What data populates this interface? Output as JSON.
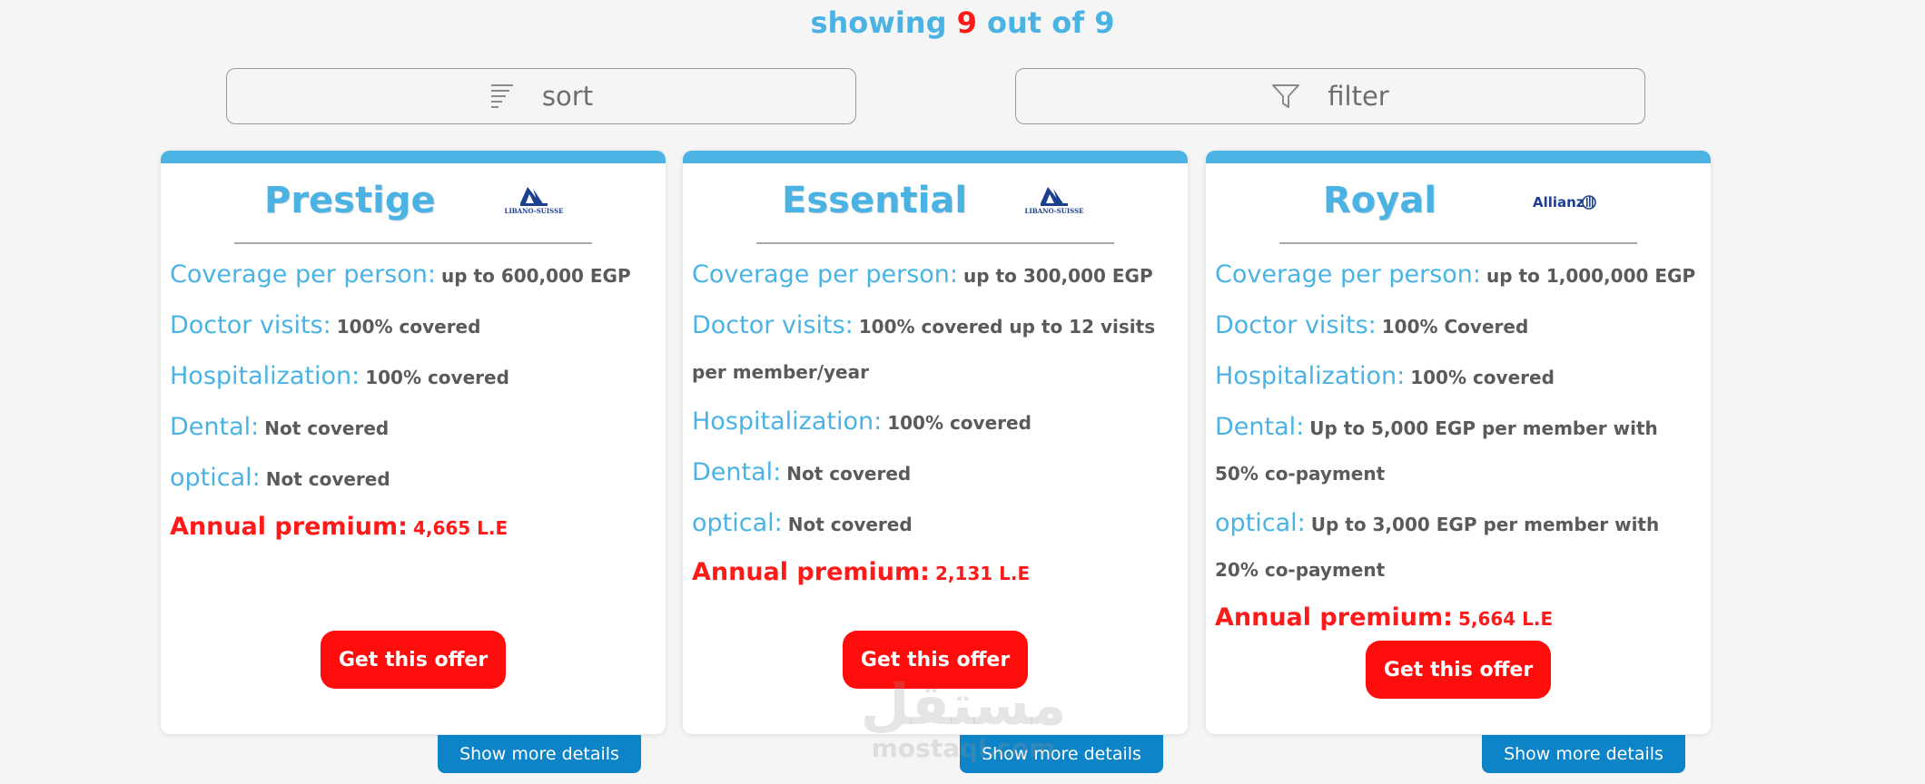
{
  "header": {
    "prefix": "showing",
    "count": "9",
    "middle": "out of",
    "total": "9"
  },
  "controls": {
    "sort_label": "sort",
    "filter_label": "filter"
  },
  "colors": {
    "accent": "#4bb3e3",
    "premium": "#ff1a1a",
    "button": "#ff0d0d",
    "details": "#0d84c7"
  },
  "cards": [
    {
      "name": "Prestige",
      "logo_text": "LIBANO-SUISSE",
      "coverage_label": "Coverage per person:",
      "coverage_value": "up to 600,000 EGP",
      "doctor_label": "Doctor visits:",
      "doctor_value": "100% covered",
      "hosp_label": "Hospitalization:",
      "hosp_value": "100% covered",
      "dental_label": "Dental:",
      "dental_value": "Not covered",
      "optical_label": "optical:",
      "optical_value": "Not covered",
      "premium_label": "Annual premium:",
      "premium_value": "4,665 L.E",
      "cta": "Get this offer",
      "details": "Show more details"
    },
    {
      "name": "Essential",
      "logo_text": "LIBANO-SUISSE",
      "coverage_label": "Coverage per person:",
      "coverage_value": "up to 300,000 EGP",
      "doctor_label": "Doctor visits:",
      "doctor_value": "100% covered up to 12 visits per member/year",
      "hosp_label": "Hospitalization:",
      "hosp_value": "100% covered",
      "dental_label": "Dental:",
      "dental_value": "Not covered",
      "optical_label": "optical:",
      "optical_value": "Not covered",
      "premium_label": "Annual premium:",
      "premium_value": "2,131 L.E",
      "cta": "Get this offer",
      "details": "Show more details"
    },
    {
      "name": "Royal",
      "logo_text": "Allianz",
      "coverage_label": "Coverage per person:",
      "coverage_value": "up to 1,000,000 EGP",
      "doctor_label": "Doctor visits:",
      "doctor_value": "100% Covered",
      "hosp_label": "Hospitalization:",
      "hosp_value": "100% covered",
      "dental_label": "Dental:",
      "dental_value": "Up to 5,000 EGP per member with 50% co-payment",
      "optical_label": "optical:",
      "optical_value": "Up to 3,000 EGP per member with 20% co-payment",
      "premium_label": "Annual premium:",
      "premium_value": "5,664 L.E",
      "cta": "Get this offer",
      "details": "Show more details"
    }
  ],
  "watermark": {
    "arabic": "مستقل",
    "latin": "mostaql.com"
  }
}
